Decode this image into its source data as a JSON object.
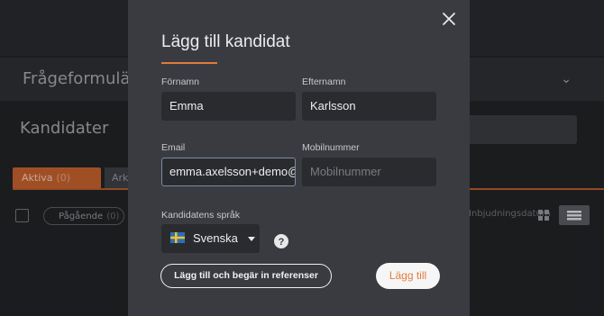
{
  "background": {
    "questionnaire_title": "Frågeformulär",
    "candidates_title": "Kandidater",
    "tabs": [
      {
        "label": "Aktiva",
        "count": "(0)"
      },
      {
        "label": "Ark"
      }
    ],
    "filter_pill": {
      "label": "Pågående",
      "count": "(0)"
    },
    "sort_label": "Inbjudningsdatum",
    "colors": {
      "accent": "#b75a2b"
    }
  },
  "modal": {
    "title": "Lägg till kandidat",
    "fields": {
      "first_name": {
        "label": "Förnamn",
        "value": "Emma"
      },
      "last_name": {
        "label": "Efternamn",
        "value": "Karlsson"
      },
      "email": {
        "label": "Email",
        "value": "emma.axelsson+demo@"
      },
      "mobile": {
        "label": "Mobilnummer",
        "placeholder": "Mobilnummer"
      }
    },
    "language": {
      "label": "Kandidatens språk",
      "value": "Svenska",
      "flag_icon": "sweden-flag-icon"
    },
    "buttons": {
      "add_and_request": "Lägg till och begär in referenser",
      "add": "Lägg till"
    },
    "colors": {
      "accent": "#e0793a",
      "panel": "#3a3b41",
      "field": "#2a2b2f"
    }
  }
}
